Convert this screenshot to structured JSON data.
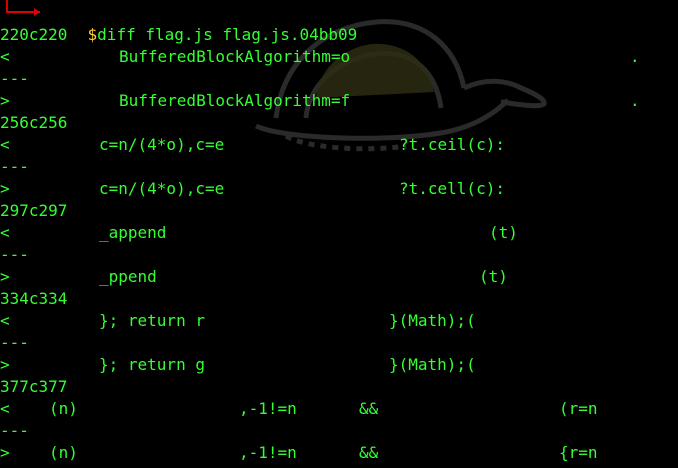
{
  "colors": {
    "background": "#000000",
    "text": "#33ff33",
    "prompt_dollar": "#ffcc33",
    "prompt_corner": "#dd0000",
    "watermark": "#2b2b2b"
  },
  "icons": {
    "prompt_corner": "prompt-corner-icon",
    "watermark": "kali-watermark-icon"
  },
  "command": {
    "dollar": "$",
    "text": "diff flag.js flag.js.04bb09"
  },
  "hunks": [
    {
      "header": "220c220",
      "old": [
        "<",
        "BufferedBlockAlgorithm=o",
        ".",
        ""
      ],
      "sep": "---",
      "new": [
        ">",
        "BufferedBlockAlgorithm=f",
        ".",
        ""
      ]
    },
    {
      "header": "256c256",
      "old": [
        "<",
        "c=n/(4*o),c=e",
        "?t.ceil(c):",
        ""
      ],
      "sep": "---",
      "new": [
        ">",
        "c=n/(4*o),c=e",
        "?t.cell(c):",
        ""
      ]
    },
    {
      "header": "297c297",
      "old": [
        "<",
        "_append",
        "(t)",
        ""
      ],
      "sep": "---",
      "new": [
        ">",
        "_ppend",
        "(t)",
        ""
      ]
    },
    {
      "header": "334c334",
      "old": [
        "<",
        "}; return r",
        "}(Math);(",
        ""
      ],
      "sep": "---",
      "new": [
        ">",
        "}; return g",
        "}(Math);(",
        ""
      ]
    },
    {
      "header": "377c377",
      "old": [
        "<",
        "(n)",
        ",-1!=n",
        "&&",
        "(r=n"
      ],
      "sep": "---",
      "new": [
        ">",
        "(n)",
        ",-1!=n",
        "&&",
        "{r=n"
      ]
    }
  ]
}
